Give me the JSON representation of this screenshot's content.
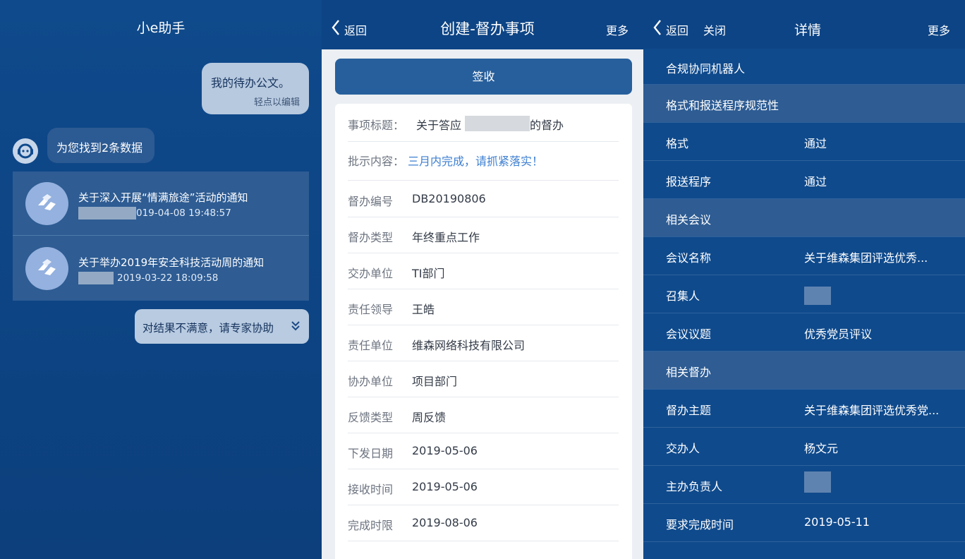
{
  "chat": {
    "title": "小e助手",
    "user_message": "我的待办公文。",
    "user_hint": "轻点以编辑",
    "bot_reply": "为您找到2条数据",
    "results": [
      {
        "title": "关于深入开展“情满旅途”活动的通知",
        "date": "019-04-08 19:48:57"
      },
      {
        "title": "关于举办2019年安全科技活动周的通知",
        "date": "2019-03-22 18:09:58"
      }
    ],
    "expert_button": "对结果不满意，请专家协助"
  },
  "create": {
    "back_label": "返回",
    "title": "创建-督办事项",
    "more_label": "更多",
    "sign_button": "签收",
    "fields": [
      {
        "label": "事项标题：",
        "value": "关于答应",
        "value2": "的督办"
      },
      {
        "label": "批示内容：",
        "value": "三月内完成，请抓紧落实！"
      },
      {
        "label": "督办编号",
        "value": "DB20190806"
      },
      {
        "label": "督办类型",
        "value": "年终重点工作"
      },
      {
        "label": "交办单位",
        "value": "TI部门"
      },
      {
        "label": "责任领导",
        "value": "王皓"
      },
      {
        "label": "责任单位",
        "value": "维森网络科技有限公司"
      },
      {
        "label": "协办单位",
        "value": "项目部门"
      },
      {
        "label": "反馈类型",
        "value": "周反馈"
      },
      {
        "label": "下发日期",
        "value": "2019-05-06"
      },
      {
        "label": "接收时间",
        "value": "2019-05-06"
      },
      {
        "label": "完成时限",
        "value": "2019-08-06"
      }
    ]
  },
  "detail": {
    "back_label": "返回",
    "close_label": "关闭",
    "title": "详情",
    "more_label": "更多",
    "rows": [
      {
        "label": "合规协同机器人",
        "value": ""
      },
      {
        "label": "格式和报送程序规范性",
        "value": ""
      },
      {
        "label": "格式",
        "value": "通过"
      },
      {
        "label": "报送程序",
        "value": "通过"
      },
      {
        "label": "相关会议",
        "value": ""
      },
      {
        "label": "会议名称",
        "value": "关于维森集团评选优秀..."
      },
      {
        "label": "召集人",
        "value": ""
      },
      {
        "label": "会议议题",
        "value": "优秀党员评议"
      },
      {
        "label": "相关督办",
        "value": ""
      },
      {
        "label": "督办主题",
        "value": "关于维森集团评选优秀党..."
      },
      {
        "label": "交办人",
        "value": "杨文元"
      },
      {
        "label": "主办负责人",
        "value": ""
      },
      {
        "label": "要求完成时间",
        "value": "2019-05-11"
      }
    ]
  },
  "colors": {
    "dark_blue": "#0f4a8c",
    "header_blue": "#0d4485",
    "section_blue": "#2e5c93",
    "accent_blue": "#3d7fd1"
  },
  "icons": {
    "bot_avatar": "robot-headset-icon",
    "result_item": "handshake-icon",
    "back": "chevron-left-icon",
    "expand": "double-chevron-down-icon"
  }
}
